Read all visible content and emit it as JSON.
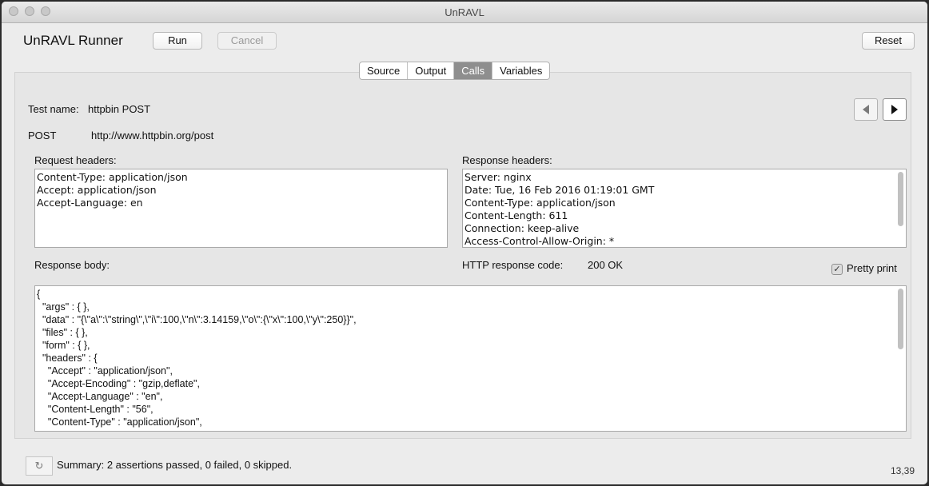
{
  "window": {
    "title": "UnRAVL"
  },
  "header": {
    "app_title": "UnRAVL Runner",
    "run_label": "Run",
    "cancel_label": "Cancel",
    "reset_label": "Reset"
  },
  "tabs": [
    {
      "label": "Source",
      "active": false
    },
    {
      "label": "Output",
      "active": false
    },
    {
      "label": "Calls",
      "active": true
    },
    {
      "label": "Variables",
      "active": false
    }
  ],
  "call": {
    "test_name_label": "Test name:",
    "test_name": "httpbin POST",
    "method": "POST",
    "url": "http://www.httpbin.org/post",
    "prev_icon": "triangle-left-icon",
    "next_icon": "triangle-right-icon"
  },
  "request_headers": {
    "label": "Request headers:",
    "lines": [
      "Content-Type: application/json",
      "Accept: application/json",
      "Accept-Language: en"
    ]
  },
  "response_headers": {
    "label": "Response headers:",
    "lines": [
      "Server: nginx",
      "Date: Tue, 16 Feb 2016 01:19:01 GMT",
      "Content-Type: application/json",
      "Content-Length: 611",
      "Connection: keep-alive",
      "Access-Control-Allow-Origin: *"
    ]
  },
  "response": {
    "body_label": "Response body:",
    "code_label": "HTTP response code:",
    "code_value": "200 OK",
    "pretty_print_label": "Pretty print",
    "pretty_print_checked": true,
    "body_lines": [
      "{",
      "  \"args\" : { },",
      "  \"data\" : \"{\\\"a\\\":\\\"string\\\",\\\"i\\\":100,\\\"n\\\":3.14159,\\\"o\\\":{\\\"x\\\":100,\\\"y\\\":250}}\",",
      "  \"files\" : { },",
      "  \"form\" : { },",
      "  \"headers\" : {",
      "    \"Accept\" : \"application/json\",",
      "    \"Accept-Encoding\" : \"gzip,deflate\",",
      "    \"Accept-Language\" : \"en\",",
      "    \"Content-Length\" : \"56\",",
      "    \"Content-Type\" : \"application/json\","
    ]
  },
  "status": {
    "icon": "refresh-icon",
    "summary": "Summary: 2 assertions passed, 0 failed, 0 skipped.",
    "cursor_position": "13,39"
  }
}
